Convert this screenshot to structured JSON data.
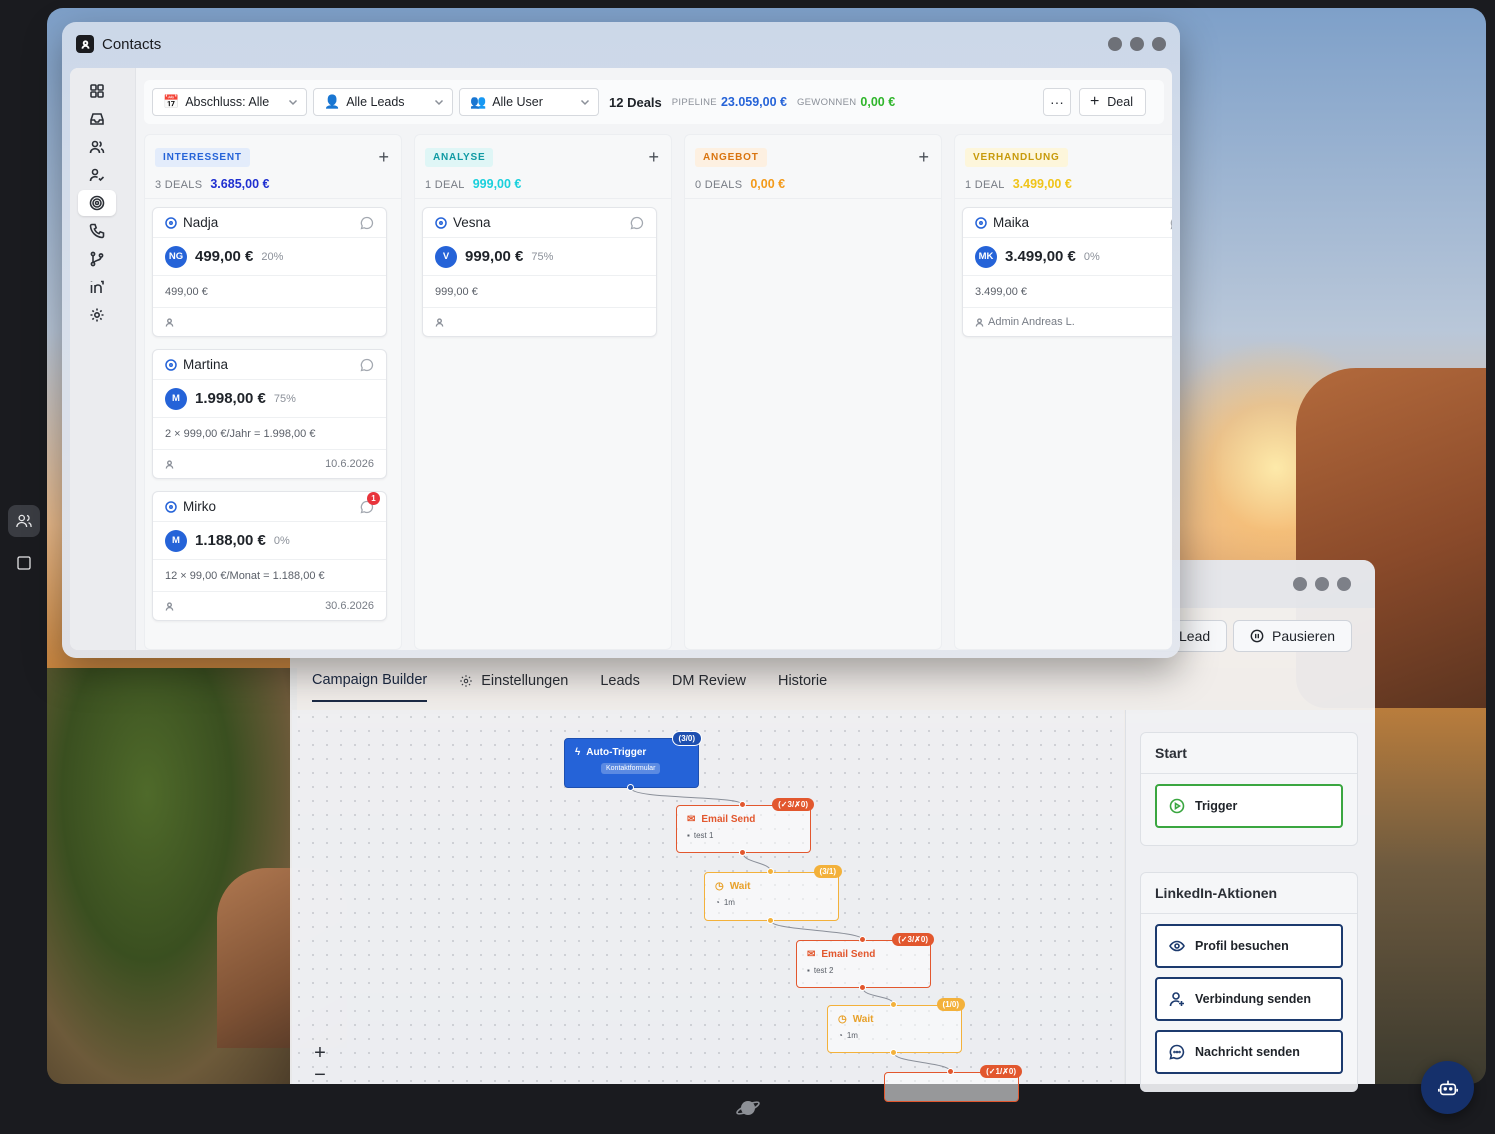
{
  "contacts_window": {
    "title": "Contacts"
  },
  "toolbar": {
    "filter_abschluss": "Abschluss: Alle",
    "filter_leads": "Alle Leads",
    "filter_user": "Alle User",
    "deals_count": "12 Deals",
    "pipeline_label": "PIPELINE",
    "pipeline_value": "23.059,00 €",
    "won_label": "GEWONNEN",
    "won_value": "0,00 €",
    "more_label": "···",
    "add_deal_label": "Deal"
  },
  "columns": [
    {
      "stage": "INTERESSENT",
      "count": "3 DEALS",
      "sum": "3.685,00 €",
      "pill_bg": "#e3ecfb",
      "pill_fg": "#2563d8",
      "sum_color": "#1f2fd0",
      "cards": [
        {
          "name": "Nadja",
          "avatar": "NG",
          "amount": "499,00 €",
          "pct": "20%",
          "calc": "499,00 €",
          "owner": "",
          "date": "",
          "notif": ""
        },
        {
          "name": "Martina",
          "avatar": "M",
          "amount": "1.998,00 €",
          "pct": "75%",
          "calc": "2 × 999,00 €/Jahr = 1.998,00 €",
          "owner": "",
          "date": "10.6.2026",
          "notif": ""
        },
        {
          "name": "Mirko",
          "avatar": "M",
          "amount": "1.188,00 €",
          "pct": "0%",
          "calc": "12 × 99,00 €/Monat = 1.188,00 €",
          "owner": "",
          "date": "30.6.2026",
          "notif": "1"
        }
      ]
    },
    {
      "stage": "ANALYSE",
      "count": "1 DEAL",
      "sum": "999,00 €",
      "pill_bg": "#dff6f6",
      "pill_fg": "#0f9aa3",
      "sum_color": "#19d0dc",
      "cards": [
        {
          "name": "Vesna",
          "avatar": "V",
          "amount": "999,00 €",
          "pct": "75%",
          "calc": "999,00 €",
          "owner": "",
          "date": "",
          "notif": ""
        }
      ]
    },
    {
      "stage": "ANGEBOT",
      "count": "0 DEALS",
      "sum": "0,00 €",
      "pill_bg": "#fdf0e1",
      "pill_fg": "#d9740f",
      "sum_color": "#f39a1a",
      "cards": []
    },
    {
      "stage": "VERHANDLUNG",
      "count": "1 DEAL",
      "sum": "3.499,00 €",
      "pill_bg": "#fdf6db",
      "pill_fg": "#c79a0a",
      "sum_color": "#f0c419",
      "cards": [
        {
          "name": "Maika",
          "avatar": "MK",
          "amount": "3.499,00 €",
          "pct": "0%",
          "calc": "3.499,00 €",
          "owner": "Admin Andreas L.",
          "date": "",
          "notif": ""
        }
      ]
    }
  ],
  "campaign_window": {
    "lead_button": "Lead",
    "pause_button": "Pausieren",
    "tabs": [
      "Campaign Builder",
      "Einstellungen",
      "Leads",
      "DM Review",
      "Historie"
    ],
    "active_tab": "Campaign Builder",
    "flow": {
      "trigger": {
        "title": "Auto-Trigger",
        "chip": "Kontaktformular",
        "badge": "(3/0)"
      },
      "email1": {
        "title": "Email Send",
        "sub": "test 1",
        "badge": "(✓3/✗0)"
      },
      "wait1": {
        "title": "Wait",
        "sub": "1m",
        "badge": "(3/1)"
      },
      "email2": {
        "title": "Email Send",
        "sub": "test 2",
        "badge": "(✓3/✗0)"
      },
      "wait2": {
        "title": "Wait",
        "sub": "1m",
        "badge": "(1/0)"
      },
      "partial_badge": "(✓1/✗0)"
    },
    "zoom_in": "+",
    "zoom_out": "−",
    "panel": {
      "start_title": "Start",
      "trigger_item": "Trigger",
      "linkedin_title": "LinkedIn-Aktionen",
      "items": [
        "Profil besuchen",
        "Verbindung senden",
        "Nachricht senden"
      ]
    }
  },
  "colors": {
    "accent_blue": "#2563d8",
    "won_green": "#2fb52b",
    "email_red": "#e2572e",
    "wait_amber": "#f3b13b"
  }
}
